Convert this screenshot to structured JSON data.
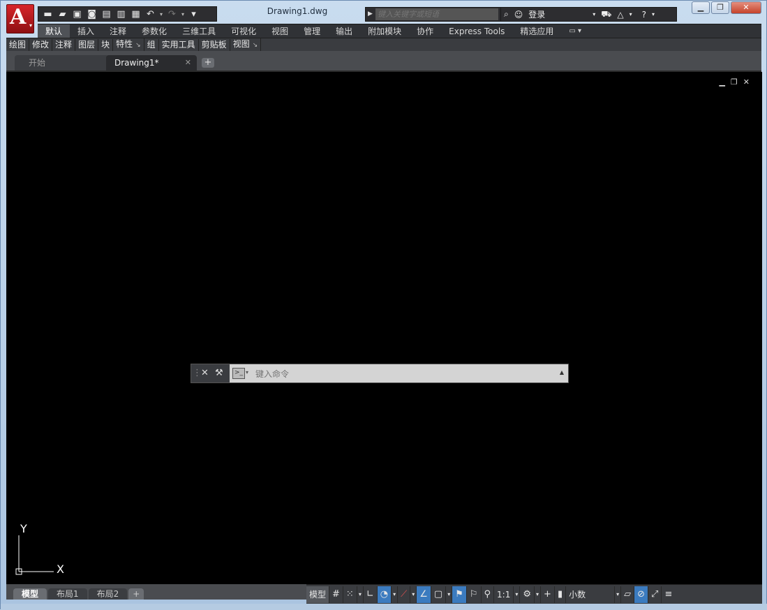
{
  "window": {
    "doc_title": "Drawing1.dwg",
    "controls": [
      "minimize",
      "restore",
      "close"
    ]
  },
  "app_button": {
    "logo": "A"
  },
  "quick_access": {
    "icons": [
      "new-icon",
      "open-icon",
      "save-icon",
      "save-as-icon",
      "open-web-icon",
      "save-web-icon",
      "print-icon",
      "undo-icon",
      "redo-icon",
      "customize-icon"
    ]
  },
  "search": {
    "placeholder": "键入关键字或短语"
  },
  "infocenter": {
    "signin": "登录"
  },
  "ribbon": {
    "tabs": [
      "默认",
      "插入",
      "注释",
      "参数化",
      "三维工具",
      "可视化",
      "视图",
      "管理",
      "输出",
      "附加模块",
      "协作",
      "Express Tools",
      "精选应用"
    ],
    "active_tab": "默认",
    "panels": [
      "绘图",
      "修改",
      "注释",
      "图层",
      "块",
      "特性",
      "组",
      "实用工具",
      "剪贴板",
      "视图"
    ]
  },
  "file_tabs": {
    "start": "开始",
    "doc": "Drawing1*"
  },
  "canvas": {
    "background": "#000000",
    "ucs_x": "X",
    "ucs_y": "Y"
  },
  "command_line": {
    "placeholder": "键入命令"
  },
  "layout_tabs": [
    "模型",
    "布局1",
    "布局2"
  ],
  "status_bar": {
    "model": "模型",
    "scale": "1:1",
    "units": "小数"
  },
  "colors": {
    "accent": "#3b7bbf",
    "app_red": "#c8161d"
  }
}
